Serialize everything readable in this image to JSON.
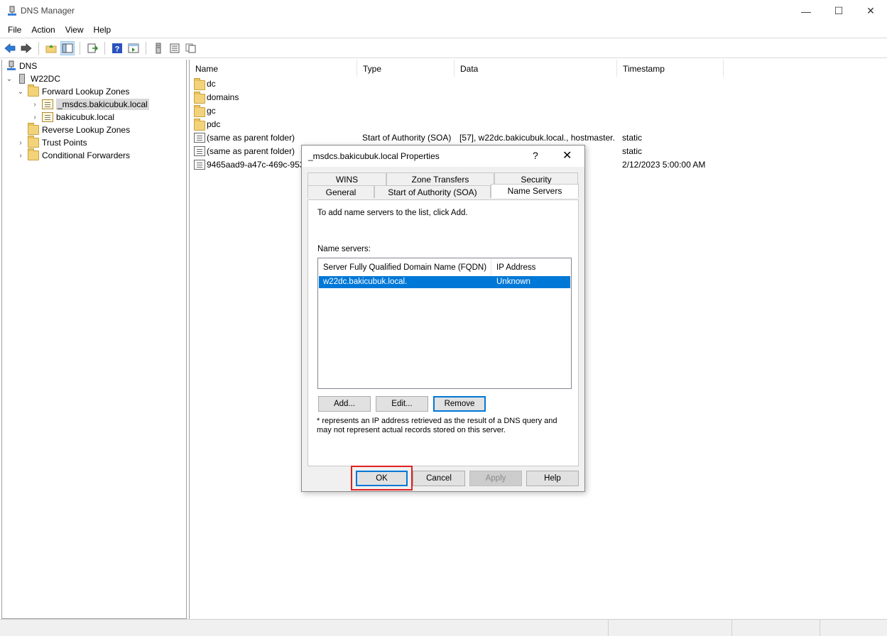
{
  "window": {
    "title": "DNS Manager",
    "icon": "dns-manager-icon",
    "controls": {
      "minimize": "—",
      "maximize": "☐",
      "close": "✕"
    }
  },
  "menu": [
    "File",
    "Action",
    "View",
    "Help"
  ],
  "toolbar": {
    "icons": [
      "back-icon",
      "forward-icon",
      "up-folder-icon",
      "show-hide-tree-icon",
      "export-list-icon",
      "help-icon",
      "action-pane-icon",
      "server-icon",
      "zone-list-icon",
      "copy-icon"
    ]
  },
  "tree": {
    "root": "DNS",
    "server": "W22DC",
    "forward_zones": "Forward Lookup Zones",
    "zone_msdcs": "_msdcs.bakicubuk.local",
    "zone_local": "bakicubuk.local",
    "reverse_zones": "Reverse Lookup Zones",
    "trust_points": "Trust Points",
    "conditional_forwarders": "Conditional Forwarders"
  },
  "list": {
    "columns": [
      "Name",
      "Type",
      "Data",
      "Timestamp"
    ],
    "rows": [
      {
        "name": "dc",
        "type": "",
        "data": "",
        "timestamp": "",
        "icon": "folder-icon"
      },
      {
        "name": "domains",
        "type": "",
        "data": "",
        "timestamp": "",
        "icon": "folder-icon"
      },
      {
        "name": "gc",
        "type": "",
        "data": "",
        "timestamp": "",
        "icon": "folder-icon"
      },
      {
        "name": "pdc",
        "type": "",
        "data": "",
        "timestamp": "",
        "icon": "folder-icon"
      },
      {
        "name": "(same as parent folder)",
        "type": "Start of Authority (SOA)",
        "data": "[57], w22dc.bakicubuk.local., hostmaster.",
        "timestamp": "static",
        "icon": "record-icon"
      },
      {
        "name": "(same as parent folder)",
        "type": "",
        "data": "",
        "timestamp": "static",
        "icon": "record-icon"
      },
      {
        "name": "9465aad9-a47c-469c-953f",
        "type": "",
        "data": "",
        "timestamp": "2/12/2023 5:00:00 AM",
        "icon": "record-icon"
      }
    ]
  },
  "dialog": {
    "title": "_msdcs.bakicubuk.local Properties",
    "help": "?",
    "close": "✕",
    "tabs_top": [
      "WINS",
      "Zone Transfers",
      "Security"
    ],
    "tabs_bottom": [
      "General",
      "Start of Authority (SOA)",
      "Name Servers"
    ],
    "instruction": "To add name servers to the list, click Add.",
    "ns_label": "Name servers:",
    "ns_columns": [
      "Server Fully Qualified Domain Name (FQDN)",
      "IP Address"
    ],
    "ns_rows": [
      {
        "fqdn": "w22dc.bakicubuk.local.",
        "ip": "Unknown"
      }
    ],
    "buttons": {
      "add": "Add...",
      "edit": "Edit...",
      "remove": "Remove"
    },
    "footnote": "* represents an IP address retrieved as the result of a DNS query and may not represent actual records stored on this server.",
    "footer": {
      "ok": "OK",
      "cancel": "Cancel",
      "apply": "Apply",
      "help": "Help"
    }
  }
}
